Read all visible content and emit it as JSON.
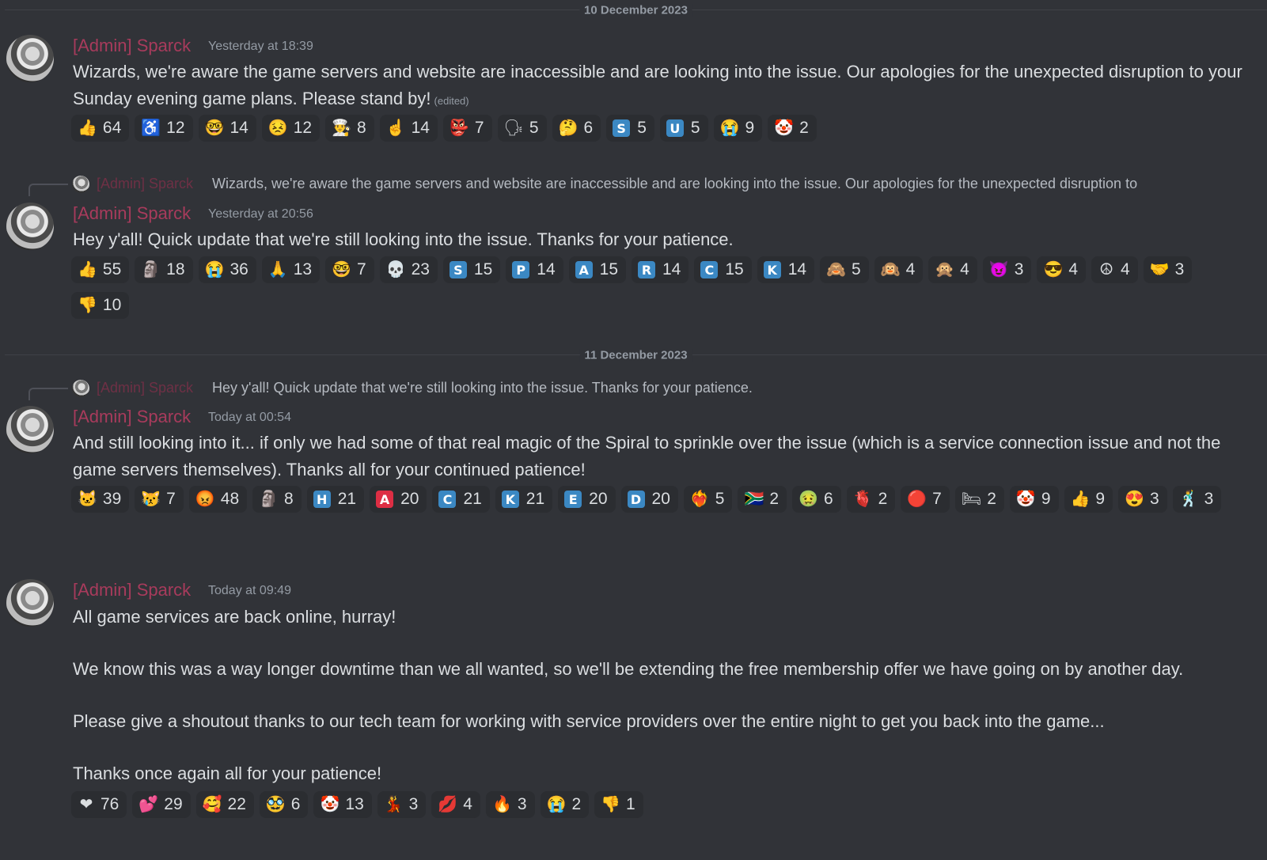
{
  "dividers": [
    {
      "label": "10 December 2023"
    },
    {
      "label": "11 December 2023"
    }
  ],
  "messages": [
    {
      "author": "[Admin] Sparck",
      "time": "Yesterday at 18:39",
      "text": "Wizards, we're aware the game servers and website are inaccessible and are looking into the issue. Our apologies for the unexpected disruption to your Sunday evening game plans. Please stand by!",
      "edited": "(edited)",
      "reactions": [
        {
          "icon": "thumbs-up",
          "glyph": "👍",
          "count": "64"
        },
        {
          "icon": "wheelchair",
          "glyph": "♿",
          "count": "12"
        },
        {
          "icon": "nerd-face",
          "glyph": "🤓",
          "count": "14"
        },
        {
          "icon": "persevering-face",
          "glyph": "😣",
          "count": "12"
        },
        {
          "icon": "man-cook",
          "glyph": "👨‍🍳",
          "count": "8"
        },
        {
          "icon": "finger-pointing-up",
          "glyph": "☝",
          "count": "14"
        },
        {
          "icon": "goblin",
          "glyph": "👺",
          "count": "7"
        },
        {
          "icon": "speaking-head",
          "glyph": "🗣",
          "count": "5"
        },
        {
          "icon": "thinking-face",
          "glyph": "🤔",
          "count": "6"
        },
        {
          "icon": "regional-s",
          "letter": "S",
          "count": "5"
        },
        {
          "icon": "regional-u",
          "letter": "U",
          "count": "5"
        },
        {
          "icon": "loudly-crying-face",
          "glyph": "😭",
          "count": "9"
        },
        {
          "icon": "clown-face",
          "glyph": "🤡",
          "count": "2"
        }
      ]
    },
    {
      "reply": {
        "author": "[Admin] Sparck",
        "text": "Wizards, we're aware the game servers and website are inaccessible and are looking into the issue. Our apologies for the unexpected disruption to"
      },
      "author": "[Admin] Sparck",
      "time": "Yesterday at 20:56",
      "text": "Hey y'all! Quick update that we're still looking into the issue. Thanks for your patience.",
      "reactions": [
        {
          "icon": "thumbs-up",
          "glyph": "👍",
          "count": "55"
        },
        {
          "icon": "moai",
          "glyph": "🗿",
          "count": "18"
        },
        {
          "icon": "loudly-crying-face",
          "glyph": "😭",
          "count": "36"
        },
        {
          "icon": "folded-hands",
          "glyph": "🙏",
          "count": "13"
        },
        {
          "icon": "nerd-face",
          "glyph": "🤓",
          "count": "7"
        },
        {
          "icon": "skull",
          "glyph": "💀",
          "count": "23"
        },
        {
          "icon": "regional-s",
          "letter": "S",
          "count": "15"
        },
        {
          "icon": "regional-p",
          "letter": "P",
          "count": "14"
        },
        {
          "icon": "regional-a",
          "letter": "A",
          "count": "15"
        },
        {
          "icon": "regional-r",
          "letter": "R",
          "count": "14"
        },
        {
          "icon": "regional-c",
          "letter": "C",
          "count": "15"
        },
        {
          "icon": "regional-k",
          "letter": "K",
          "count": "14"
        },
        {
          "icon": "see-no-evil",
          "glyph": "🙈",
          "count": "5"
        },
        {
          "icon": "hear-no-evil",
          "glyph": "🙉",
          "count": "4"
        },
        {
          "icon": "speak-no-evil",
          "glyph": "🙊",
          "count": "4"
        },
        {
          "icon": "smiling-devil",
          "glyph": "😈",
          "count": "3"
        },
        {
          "icon": "sunglasses-face",
          "glyph": "😎",
          "count": "4"
        },
        {
          "icon": "peace-symbol",
          "glyph": "☮",
          "count": "4"
        },
        {
          "icon": "handshake",
          "glyph": "🤝",
          "count": "3"
        },
        {
          "icon": "thumbs-down",
          "glyph": "👎",
          "count": "10"
        }
      ]
    },
    {
      "reply": {
        "author": "[Admin] Sparck",
        "text": "Hey y'all! Quick update that we're still looking into the issue. Thanks for your patience."
      },
      "author": "[Admin] Sparck",
      "time": "Today at 00:54",
      "text": "And still looking into it... if only we had some of that real magic of the Spiral to sprinkle over the issue (which is a service connection issue and not the game servers themselves). Thanks all for your continued patience!",
      "reactions": [
        {
          "icon": "pikachu",
          "glyph": "🐱",
          "count": "39"
        },
        {
          "icon": "cat-face",
          "glyph": "😿",
          "count": "7"
        },
        {
          "icon": "angry-face",
          "glyph": "😡",
          "count": "48"
        },
        {
          "icon": "moai",
          "glyph": "🗿",
          "count": "8"
        },
        {
          "icon": "regional-h",
          "letter": "H",
          "count": "21"
        },
        {
          "icon": "regional-a-red",
          "letter": "A",
          "red": true,
          "count": "20"
        },
        {
          "icon": "regional-c",
          "letter": "C",
          "count": "21"
        },
        {
          "icon": "regional-k",
          "letter": "K",
          "count": "21"
        },
        {
          "icon": "regional-e",
          "letter": "E",
          "count": "20"
        },
        {
          "icon": "regional-d",
          "letter": "D",
          "count": "20"
        },
        {
          "icon": "heart-on-fire",
          "glyph": "❤‍🔥",
          "count": "5"
        },
        {
          "icon": "south-africa-flag",
          "glyph": "🇿🇦",
          "count": "2"
        },
        {
          "icon": "nauseated-face",
          "glyph": "🤢",
          "count": "6"
        },
        {
          "icon": "anatomical-heart",
          "glyph": "🫀",
          "count": "2"
        },
        {
          "icon": "red-ball",
          "glyph": "🔴",
          "count": "7"
        },
        {
          "icon": "bed",
          "glyph": "🛏",
          "count": "2"
        },
        {
          "icon": "clown-face",
          "glyph": "🤡",
          "count": "9"
        },
        {
          "icon": "thumbs-up",
          "glyph": "👍",
          "count": "9"
        },
        {
          "icon": "heart-eyes",
          "glyph": "😍",
          "count": "3"
        },
        {
          "icon": "dancer",
          "glyph": "🕺",
          "count": "3"
        }
      ]
    },
    {
      "author": "[Admin] Sparck",
      "time": "Today at 09:49",
      "paragraphs": [
        "All game services are back online, hurray!",
        "We know this was a way longer downtime than we all wanted, so we'll be extending the free membership offer we have going on by another day.",
        "Please give a shoutout thanks to our tech team for working with service providers over the entire night to get you back into the game...",
        "Thanks once again all for your patience!"
      ],
      "reactions": [
        {
          "icon": "red-heart",
          "glyph": "❤",
          "count": "76"
        },
        {
          "icon": "two-hearts",
          "glyph": "💕",
          "count": "29"
        },
        {
          "icon": "smiling-hearts-face",
          "glyph": "🥰",
          "count": "22"
        },
        {
          "icon": "disguised-face",
          "glyph": "🥸",
          "count": "6"
        },
        {
          "icon": "clown-face",
          "glyph": "🤡",
          "count": "13"
        },
        {
          "icon": "person-dancing",
          "glyph": "💃",
          "count": "3"
        },
        {
          "icon": "kiss-lips",
          "glyph": "💋",
          "count": "4"
        },
        {
          "icon": "fire",
          "glyph": "🔥",
          "count": "3"
        },
        {
          "icon": "loudly-crying-face",
          "glyph": "😭",
          "count": "2"
        },
        {
          "icon": "thumbs-down",
          "glyph": "👎",
          "count": "1"
        }
      ]
    }
  ]
}
